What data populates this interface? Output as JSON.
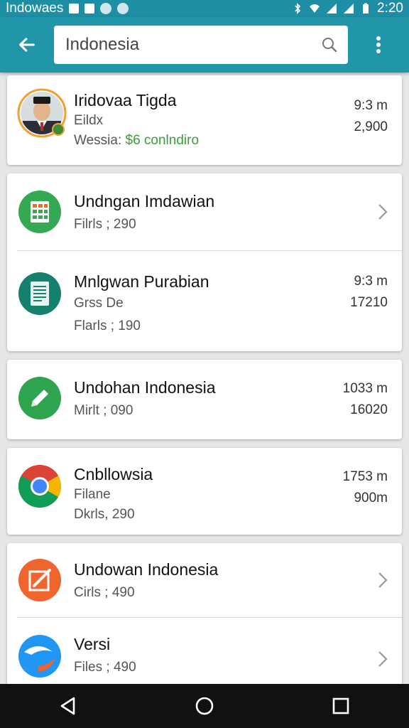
{
  "status_bar": {
    "left_text": "Indowaes",
    "time": "2:20",
    "icons": [
      "app-icon",
      "app-icon",
      "round-icon",
      "round-icon",
      "bluetooth-icon",
      "wifi-icon",
      "cell-signal-icon",
      "cell-signal-icon",
      "battery-icon"
    ]
  },
  "toolbar": {
    "back_icon": "arrow-left-icon",
    "search_value": "Indonesia",
    "search_icon": "search-icon",
    "menu_icon": "more-vert-icon"
  },
  "list": {
    "card1": {
      "title": "Iridovaa Tigda",
      "line2": "Eildx",
      "line3_prefix": "Wessia: ",
      "line3_highlight": "$6 conlndiro",
      "time": "9:3 m",
      "count": "2,900",
      "icon": "avatar-photo"
    },
    "card2": {
      "rows": [
        {
          "title": "Undngan Imdawian",
          "line2": "Filrls ; 290",
          "icon": "spreadsheet-icon"
        },
        {
          "title": "Mnlgwan Purabian",
          "line2": "Grss De",
          "line3": "Flarls ; 190",
          "time": "9:3 m",
          "count": "17210",
          "icon": "document-icon"
        }
      ]
    },
    "card3": {
      "title": "Undohan Indonesia",
      "line2": "Mirlt ; 090",
      "time": "1033 m",
      "count": "16020",
      "icon": "pencil-icon"
    },
    "card4": {
      "title": "Cnbllowsia",
      "line2": "Filane",
      "line3": "Dkrls, 290",
      "time": "1753 m",
      "count": "900m",
      "icon": "chrome-icon"
    },
    "card5": {
      "rows": [
        {
          "title": "Undowan Indonesia",
          "line2": "Cirls ; 490",
          "icon": "edit-square-icon"
        },
        {
          "title": "Versi",
          "line2": "Files ; 490",
          "icon": "swirl-icon"
        }
      ]
    }
  },
  "colors": {
    "accent": "#2196a9",
    "status_bar": "#1e8ea4",
    "highlight_green": "#3b9b3b",
    "sheets_green": "#34a853",
    "docs_teal": "#16806f",
    "orange": "#f0652d",
    "blue": "#2196f3"
  },
  "nav_bar": {
    "icons": [
      "back-triangle-icon",
      "home-circle-icon",
      "recents-square-icon"
    ]
  }
}
